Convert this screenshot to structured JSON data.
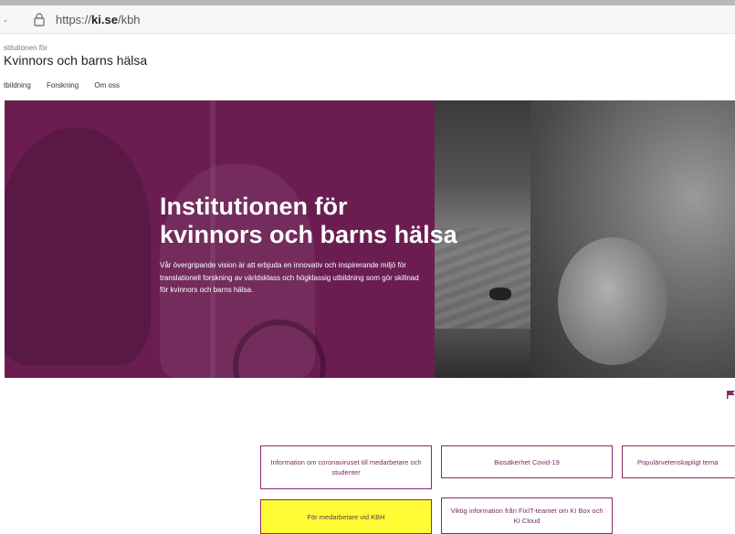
{
  "browser": {
    "dash": "-",
    "url_prefix": "https://",
    "url_domain": "ki.se",
    "url_path": "/kbh"
  },
  "header": {
    "dept_small": "stitutionen för",
    "dept_name": "Kvinnors och barns hälsa"
  },
  "nav": {
    "items": [
      "tbildning",
      "Forskning",
      "Om oss"
    ]
  },
  "hero": {
    "title_line1": "Institutionen för",
    "title_line2": "kvinnors och barns hälsa",
    "text": "Vår övergripande vision är att erbjuda en innovativ och inspirerande miljö för translationell forskning av världsklass och högklassig utbildning som gör skillnad för kvinnors och barns hälsa.",
    "accent_color": "#6b1d52"
  },
  "cards": {
    "corona": "Information om coronaviruset till medarbetare och studenter",
    "bio": "Biosäkerhet Covid-19",
    "pop": "Populärvetenskapligt tema",
    "staff": "För medarbetare vid KBH",
    "fixit": "Viktig information från FixIT-teamet om KI Box och KI Cloud"
  },
  "colors": {
    "brand": "#8b2a6b",
    "highlight": "#fffb34"
  }
}
